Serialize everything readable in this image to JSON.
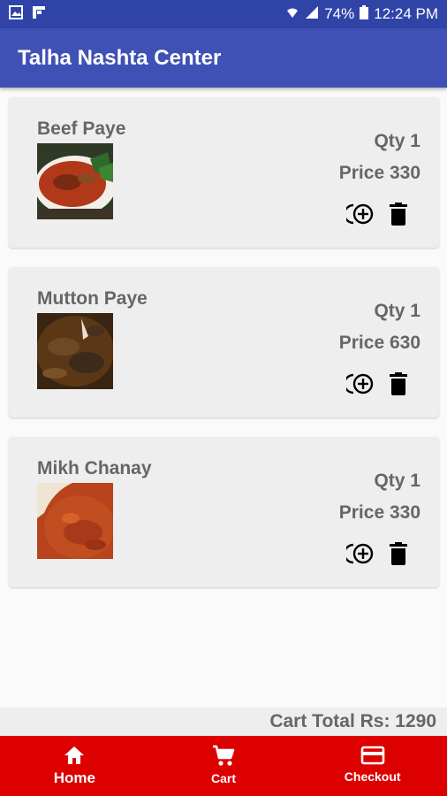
{
  "status_bar": {
    "battery": "74%",
    "time": "12:24 PM",
    "left_icons": [
      "image-icon",
      "flipboard-icon"
    ],
    "right_icons": [
      "wifi-icon",
      "signal-icon",
      "battery-icon"
    ]
  },
  "app_bar": {
    "title": "Talha Nashta Center"
  },
  "cart_items": [
    {
      "name": "Beef Paye",
      "qty": "Qty 1",
      "price": "Price 330",
      "image": "beef-paye-photo"
    },
    {
      "name": "Mutton Paye",
      "qty": "Qty 1",
      "price": "Price 630",
      "image": "mutton-paye-photo"
    },
    {
      "name": "Mikh Chanay",
      "qty": "Qty 1",
      "price": "Price 330",
      "image": "mikh-chanay-photo"
    }
  ],
  "cart_total": "Cart Total Rs: 1290",
  "bottom_nav": [
    {
      "label": "Home",
      "icon": "home-icon"
    },
    {
      "label": "Cart",
      "icon": "cart-icon"
    },
    {
      "label": "Checkout",
      "icon": "credit-card-icon"
    }
  ],
  "colors": {
    "status_bar": "#3044a8",
    "app_bar": "#3f51b5",
    "bottom_nav": "#dd0000",
    "card_bg": "#eeeeee",
    "text_gray": "#666666"
  }
}
